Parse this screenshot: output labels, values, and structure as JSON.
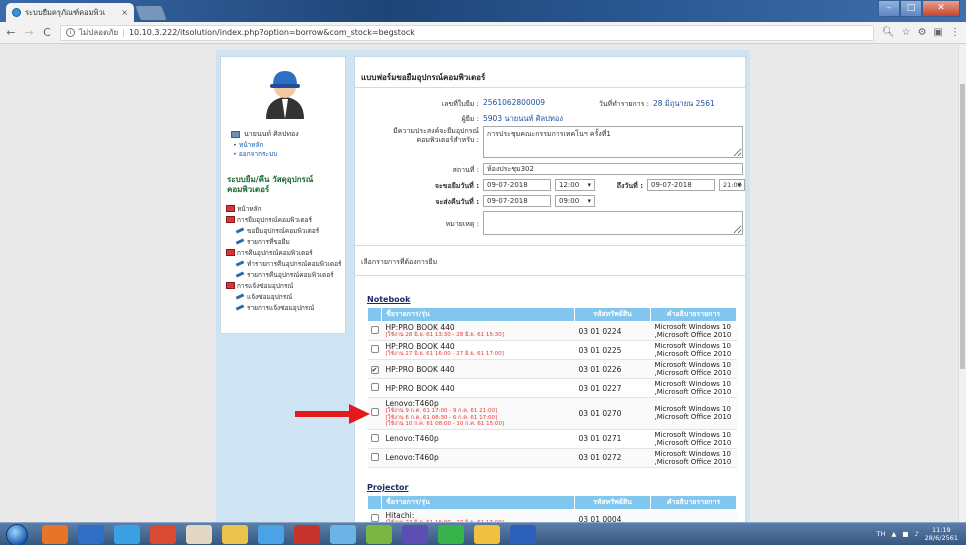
{
  "browser": {
    "tab_title": "ระบบยืม-คืนวัสดุฯ ×",
    "tab_title_short": "ระบบยืมครุภัณฑ์คอมพิวเ",
    "tab_close": "×",
    "security_label": "ไม่ปลอดภัย",
    "url": "10.10.3.222/itsolution/index.php?option=borrow&com_stock=begstock"
  },
  "sidebar": {
    "user_name": "นายนนท์ ศิลปทอง",
    "links": [
      "หน้าหลัก",
      "ออกจากระบบ"
    ],
    "system_heading": "ระบบยืม/คืน วัสดุอุปกรณ์คอมพิวเตอร์",
    "menu": [
      {
        "type": "section",
        "label": "หน้าหลัก"
      },
      {
        "type": "section",
        "label": "การยืมอุปกรณ์คอมพิวเตอร์"
      },
      {
        "type": "item",
        "label": "ขอยืมอุปกรณ์คอมพิวเตอร์"
      },
      {
        "type": "item",
        "label": "รายการที่ขอยืม"
      },
      {
        "type": "section",
        "label": "การคืนอุปกรณ์คอมพิวเตอร์"
      },
      {
        "type": "item",
        "label": "ทำรายการคืนอุปกรณ์คอมพิวเตอร์"
      },
      {
        "type": "item",
        "label": "รายการคืนอุปกรณ์คอมพิวเตอร์"
      },
      {
        "type": "section",
        "label": "การแจ้งซ่อมอุปกรณ์"
      },
      {
        "type": "item",
        "label": "แจ้งซ่อมอุปกรณ์"
      },
      {
        "type": "item",
        "label": "รายการแจ้งซ่อมอุปกรณ์"
      }
    ]
  },
  "form": {
    "title": "แบบฟอร์มขอยืมอุปกรณ์คอมพิวเตอร์",
    "doc_no_label": "เลขที่ใบยืม :",
    "doc_no": "2561062800009",
    "date_label": "วันที่ทำรายการ :",
    "date": "28 มิถุนายน 2561",
    "borrower_label": "ผู้ยืม :",
    "borrower": "5903 นายนนท์ ศิลปทอง",
    "purpose_label": "มีความประสงค์จะยืมอุปกรณ์คอมพิวเตอร์สำหรับ :",
    "purpose": "การประชุมคณะกรรมการเทคโนฯ ครั้งที่1",
    "place_label": "สถานที่ :",
    "place": "ห้องประชุม302",
    "from_label": "จะขอยืมวันที่ :",
    "from_date": "09-07-2018",
    "from_time": "12:00",
    "to_label": "ถึงวันที่ :",
    "to_date": "09-07-2018",
    "to_time": "21:00",
    "return_label": "จะส่งคืนวันที่ :",
    "return_date": "09-07-2018",
    "return_time": "09:00",
    "note_label": "หมายเหตุ :",
    "note": "",
    "choose_label": "เลือกรายการที่ต้องการยืม"
  },
  "table_headers": {
    "model": "ชื่อรายการ/รุ่น",
    "code": "รหัสทรัพย์สิน",
    "desc": "คำอธิบายรายการ"
  },
  "notebook": {
    "title": "Notebook",
    "rows": [
      {
        "model": "HP:PRO BOOK 440",
        "bookings": [
          "[ใช้งาน 28 มิ.ย. 61 13:30 - 28 มิ.ย. 61 15:30]"
        ],
        "code": "03 01 0224",
        "desc1": "Microsoft Windows 10",
        "desc2": ",Microsoft Office 2010",
        "checked": false
      },
      {
        "model": "HP:PRO BOOK 440",
        "bookings": [
          "[ใช้งาน 27 มิ.ย. 61 16:00 - 27 มิ.ย. 61 17:00]"
        ],
        "code": "03 01 0225",
        "desc1": "Microsoft Windows 10",
        "desc2": ",Microsoft Office 2010",
        "checked": false
      },
      {
        "model": "HP:PRO BOOK 440",
        "bookings": [],
        "code": "03 01 0226",
        "desc1": "Microsoft Windows 10",
        "desc2": ",Microsoft Office 2010",
        "checked": true
      },
      {
        "model": "HP:PRO BOOK 440",
        "bookings": [],
        "code": "03 01 0227",
        "desc1": "Microsoft Windows 10",
        "desc2": ",Microsoft Office 2010",
        "checked": false
      },
      {
        "model": "Lenovo:T460p",
        "bookings": [
          "[ใช้งาน 9 ก.ค. 61 17:00 - 9 ก.ค. 61 21:00]",
          "[ใช้งาน 6 ก.ค. 61 08:30 - 6 ก.ค. 61 17:00]",
          "[ใช้งาน 10 ก.ค. 61 08:00 - 10 ก.ค. 61 15:00]"
        ],
        "code": "03 01 0270",
        "desc1": "Microsoft Windows 10",
        "desc2": ",Microsoft Office 2010",
        "checked": false
      },
      {
        "model": "Lenovo:T460p",
        "bookings": [],
        "code": "03 01 0271",
        "desc1": "Microsoft Windows 10",
        "desc2": ",Microsoft Office 2010",
        "checked": false
      },
      {
        "model": "Lenovo:T460p",
        "bookings": [],
        "code": "03 01 0272",
        "desc1": "Microsoft Windows 10",
        "desc2": ",Microsoft Office 2010",
        "checked": false
      }
    ]
  },
  "projector": {
    "title": "Projector",
    "rows": [
      {
        "model": "Hitachi:",
        "bookings": [
          "[ใช้งาน 27 มิ.ย. 61 16:00 - 27 มิ.ย. 61 17:00]"
        ],
        "code": "03 01 0004",
        "desc1": "",
        "desc2": "",
        "checked": false
      }
    ]
  },
  "taskbar": {
    "lang": "TH",
    "time": "11:19",
    "date": "28/6/2561"
  }
}
